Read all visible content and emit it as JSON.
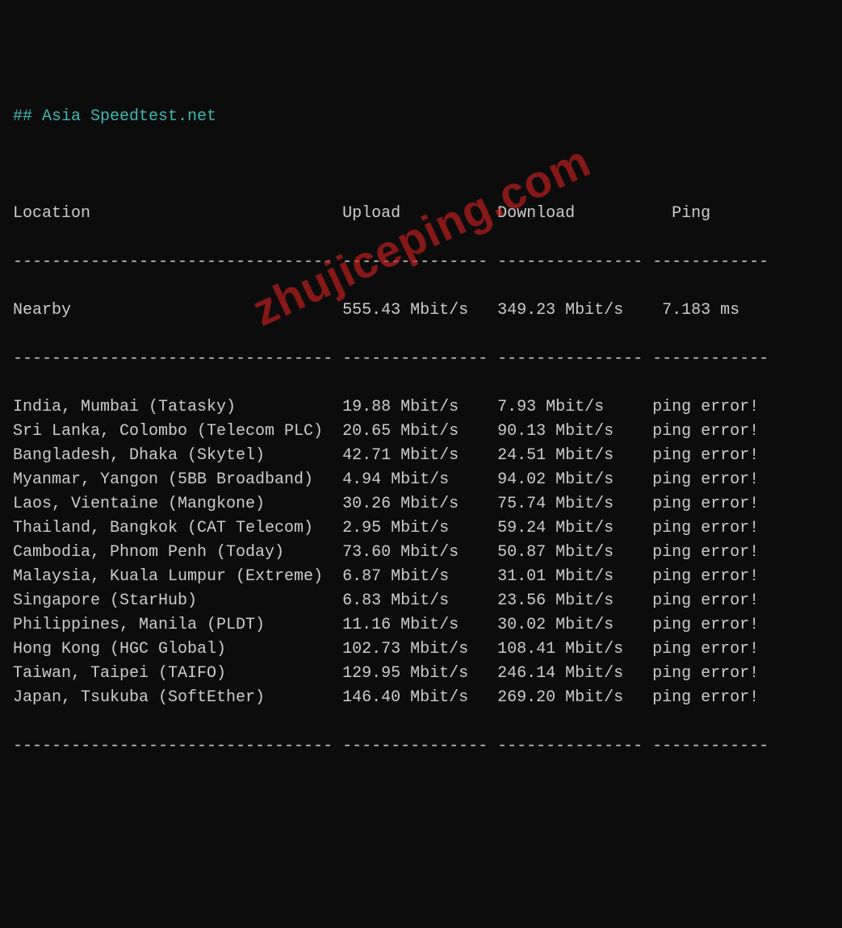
{
  "heading": "## Asia Speedtest.net",
  "columns": {
    "location": "Location",
    "upload": "Upload",
    "download": "Download",
    "ping": "Ping"
  },
  "nearby": {
    "label": "Nearby",
    "upload": "555.43 Mbit/s",
    "download": "349.23 Mbit/s",
    "ping": "7.183 ms"
  },
  "rows": [
    {
      "location": "India, Mumbai (Tatasky)",
      "upload": "19.88 Mbit/s",
      "download": "7.93 Mbit/s",
      "ping": "ping error!"
    },
    {
      "location": "Sri Lanka, Colombo (Telecom PLC)",
      "upload": "20.65 Mbit/s",
      "download": "90.13 Mbit/s",
      "ping": "ping error!"
    },
    {
      "location": "Bangladesh, Dhaka (Skytel)",
      "upload": "42.71 Mbit/s",
      "download": "24.51 Mbit/s",
      "ping": "ping error!"
    },
    {
      "location": "Myanmar, Yangon (5BB Broadband)",
      "upload": "4.94 Mbit/s",
      "download": "94.02 Mbit/s",
      "ping": "ping error!"
    },
    {
      "location": "Laos, Vientaine (Mangkone)",
      "upload": "30.26 Mbit/s",
      "download": "75.74 Mbit/s",
      "ping": "ping error!"
    },
    {
      "location": "Thailand, Bangkok (CAT Telecom)",
      "upload": "2.95 Mbit/s",
      "download": "59.24 Mbit/s",
      "ping": "ping error!"
    },
    {
      "location": "Cambodia, Phnom Penh (Today)",
      "upload": "73.60 Mbit/s",
      "download": "50.87 Mbit/s",
      "ping": "ping error!"
    },
    {
      "location": "Malaysia, Kuala Lumpur (Extreme)",
      "upload": "6.87 Mbit/s",
      "download": "31.01 Mbit/s",
      "ping": "ping error!"
    },
    {
      "location": "Singapore (StarHub)",
      "upload": "6.83 Mbit/s",
      "download": "23.56 Mbit/s",
      "ping": "ping error!"
    },
    {
      "location": "Philippines, Manila (PLDT)",
      "upload": "11.16 Mbit/s",
      "download": "30.02 Mbit/s",
      "ping": "ping error!"
    },
    {
      "location": "Hong Kong (HGC Global)",
      "upload": "102.73 Mbit/s",
      "download": "108.41 Mbit/s",
      "ping": "ping error!"
    },
    {
      "location": "Taiwan, Taipei (TAIFO)",
      "upload": "129.95 Mbit/s",
      "download": "246.14 Mbit/s",
      "ping": "ping error!"
    },
    {
      "location": "Japan, Tsukuba (SoftEther)",
      "upload": "146.40 Mbit/s",
      "download": "269.20 Mbit/s",
      "ping": "ping error!"
    }
  ],
  "watermark": "zhujiceping.com"
}
